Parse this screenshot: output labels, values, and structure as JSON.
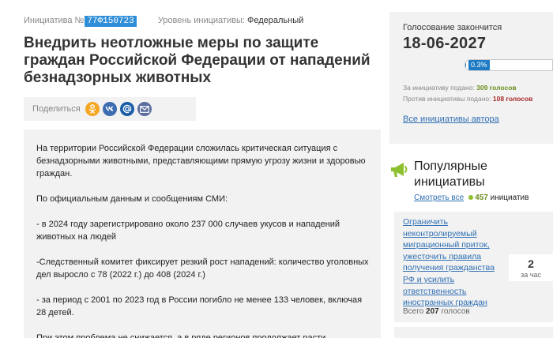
{
  "initiative": {
    "number_label": "Инициатива №",
    "number": "77Ф150723",
    "level_label": "Уровень инициативы:",
    "level_value": "Федеральный",
    "title": "Внедрить неотложные меры по защите граждан Российской Федерации от нападений безнадзорных животных",
    "share_label": "Поделиться",
    "share_buttons": [
      {
        "icon": "odnoklassniki-icon",
        "color": "#f5a623"
      },
      {
        "icon": "vkontakte-icon",
        "color": "#3d6db0"
      },
      {
        "icon": "mail-at-icon",
        "color": "#1a5ea8"
      },
      {
        "icon": "envelope-icon",
        "color": "#5b6d9e"
      }
    ],
    "paragraphs": [
      "На территории Российской Федерации сложилась критическая ситуация с безнадзорными животными, представляющими прямую угрозу жизни и здоровью граждан.",
      "По официальным данным и сообщениям СМИ:",
      "- в 2024 году зарегистрировано около 237 000 случаев укусов и нападений животных на людей",
      "-Следственный комитет фиксирует резкий рост нападений: количество уголовных дел выросло с 78 (2022 г.) до 408 (2024 г.)",
      "- за период с 2001 по 2023 год в России погибло не менее 133 человек, включая 28 детей.",
      "При этом проблема не снижается, а в ряде регионов продолжает расти."
    ]
  },
  "voting": {
    "ends_label": "Голосование закончится",
    "end_date": "18-06-2027",
    "progress_text": "0.3%",
    "progress_fraction": 0.003,
    "for_label": "За инициативу подано:",
    "for_votes": "309 голосов",
    "against_label": "Против инициативы подано:",
    "against_votes": "108 голосов",
    "author_link": "Все инициативы автора"
  },
  "popular": {
    "title": "Популярные инициативы",
    "see_all": "Смотреть все",
    "count": "457",
    "count_suffix": "инициатив",
    "items": [
      {
        "title": "Ограничить неконтролируемый миграционный приток, ужесточить правила получения гражданства РФ и усилить ответственность иностранных граждан",
        "total_label": "Всего",
        "total_value": "207",
        "total_suffix": "голосов",
        "days_number": "2",
        "days_unit": "за час"
      }
    ]
  },
  "colors": {
    "accent_blue": "#2f8ed8",
    "link": "#2f6fb3",
    "for_green": "#6a8e1f",
    "against_red": "#a52a2a",
    "panel_bg": "#f2f2f2"
  }
}
